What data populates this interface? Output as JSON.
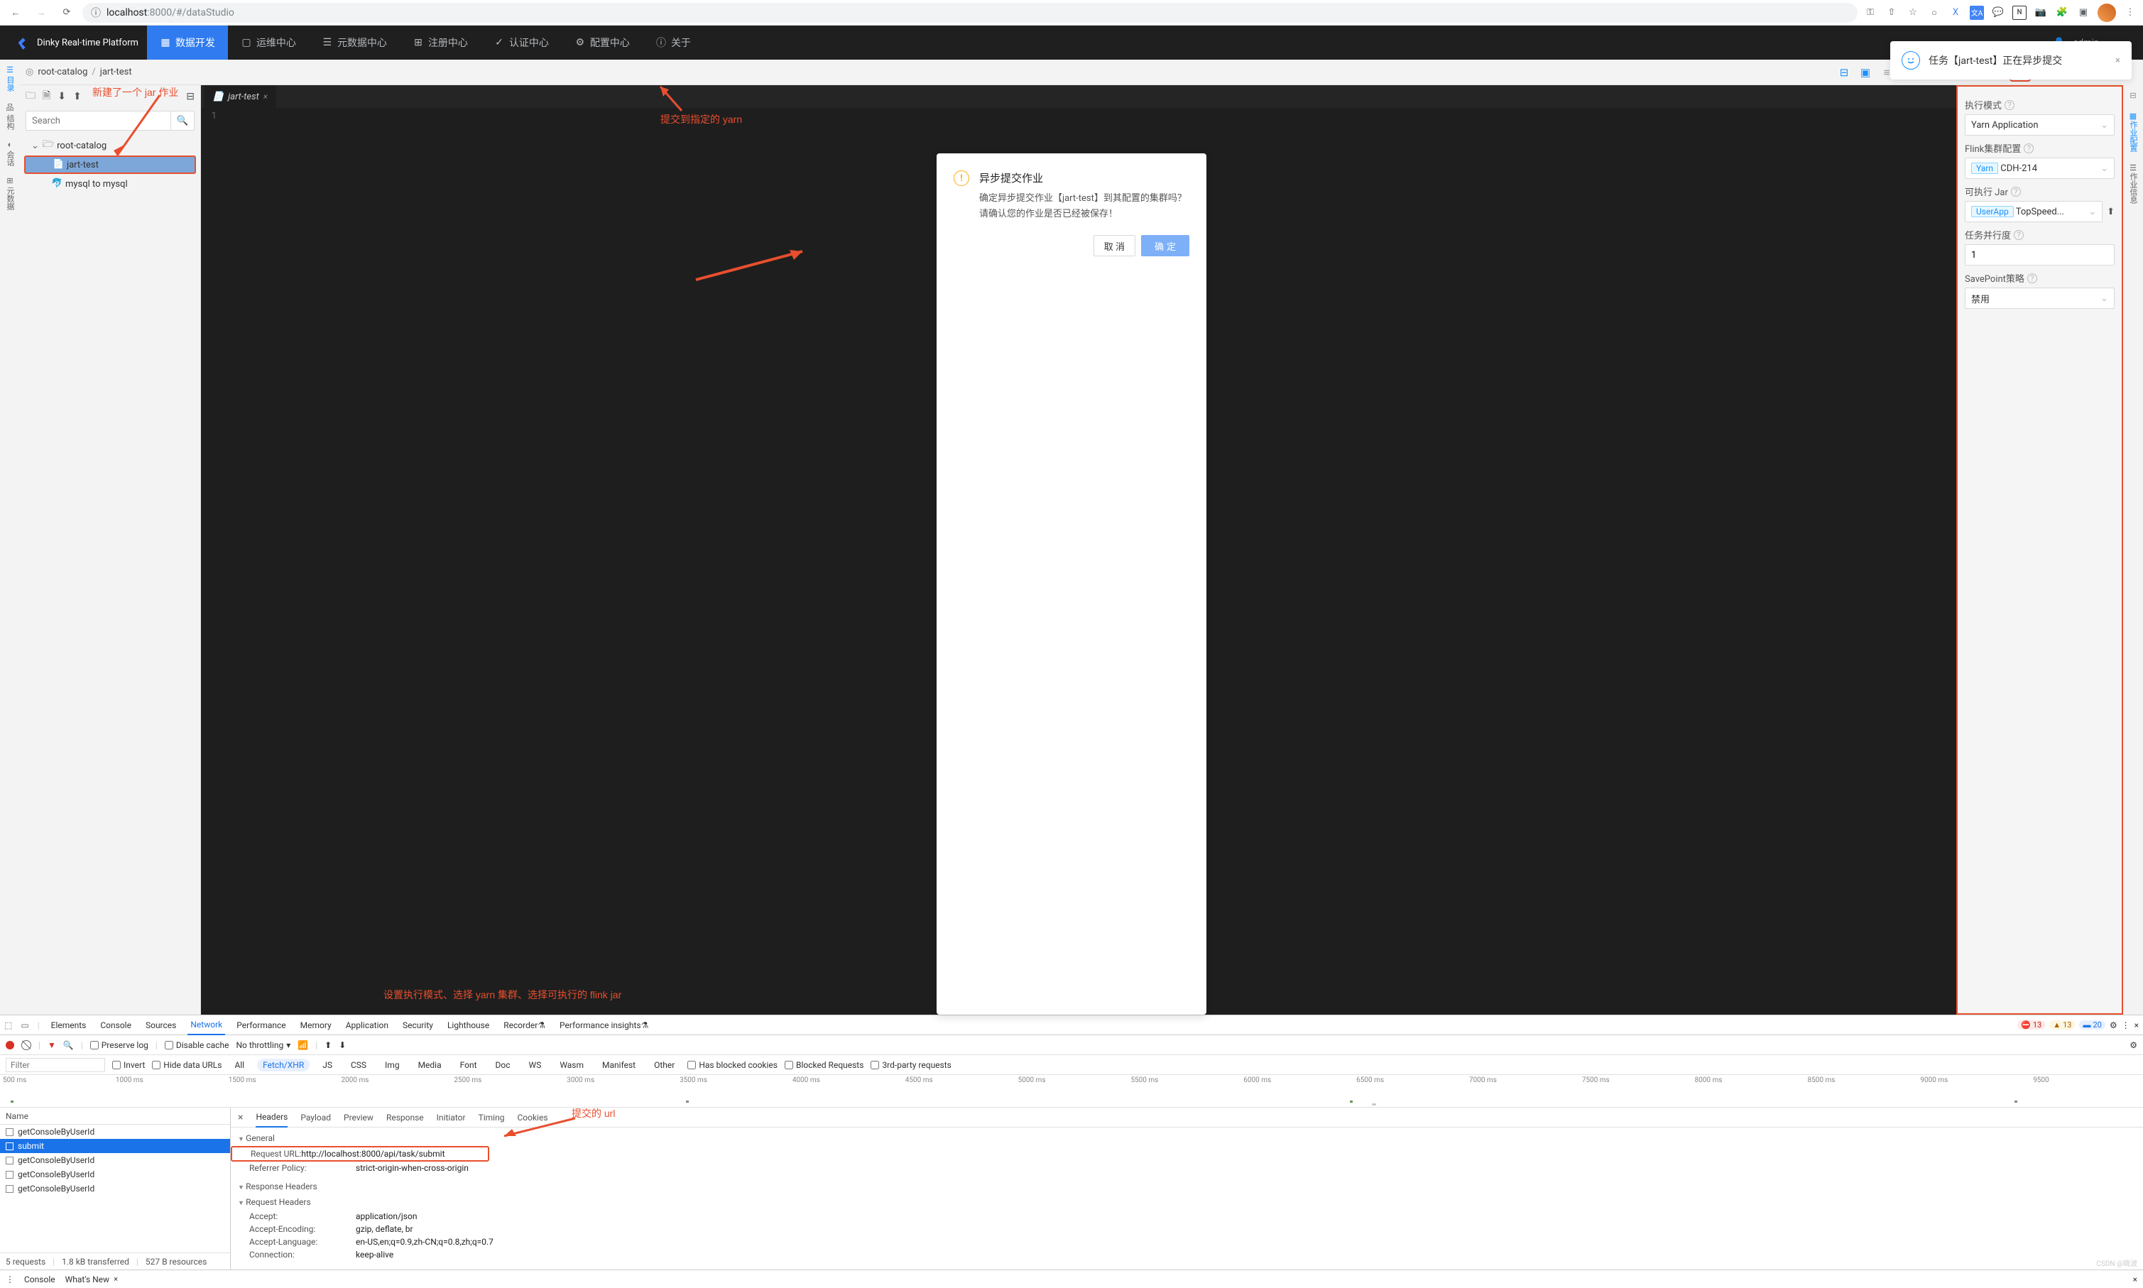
{
  "browser": {
    "url_host": "localhost",
    "url_port": ":8000",
    "url_path": "/#/dataStudio"
  },
  "header": {
    "app_name": "Dinky Real-time Platform",
    "nav": [
      {
        "label": "数据开发"
      },
      {
        "label": "运维中心"
      },
      {
        "label": "元数据中心"
      },
      {
        "label": "注册中心"
      },
      {
        "label": "认证中心"
      },
      {
        "label": "配置中心"
      },
      {
        "label": "关于"
      }
    ],
    "user": "admin"
  },
  "breadcrumb": {
    "root": "root-catalog",
    "current": "jart-test"
  },
  "left_rail": [
    {
      "label": "目录"
    },
    {
      "label": "结构"
    },
    {
      "label": "会话"
    },
    {
      "label": "元数据"
    }
  ],
  "right_rail": [
    {
      "label": "作业配置"
    },
    {
      "label": "作业信息"
    }
  ],
  "tree": {
    "search_placeholder": "Search",
    "root": "root-catalog",
    "items": [
      {
        "name": "jart-test"
      },
      {
        "name": "mysql to mysql"
      }
    ]
  },
  "editor": {
    "tab_name": "jart-test",
    "line": "1"
  },
  "right_panel": {
    "exec_mode_label": "执行模式",
    "exec_mode_value": "Yarn Application",
    "cluster_label": "Flink集群配置",
    "cluster_tag": "Yarn",
    "cluster_value": "CDH-214",
    "jar_label": "可执行 Jar",
    "jar_tag": "UserApp",
    "jar_value": "TopSpeed...",
    "parallel_label": "任务并行度",
    "parallel_value": "1",
    "savepoint_label": "SavePoint策略",
    "savepoint_value": "禁用"
  },
  "modal": {
    "title": "异步提交作业",
    "body": "确定异步提交作业【jart-test】到其配置的集群吗？请确认您的作业是否已经被保存！",
    "cancel": "取 消",
    "ok": "确定"
  },
  "toast": {
    "message": "任务【jart-test】正在异步提交"
  },
  "annotations": {
    "new_jar": "新建了一个 jar 作业",
    "submit_yarn": "提交到指定的 yarn",
    "config_note": "设置执行模式、选择 yarn 集群、选择可执行的 flink jar",
    "submit_url": "提交的 url"
  },
  "devtools": {
    "tabs": [
      "Elements",
      "Console",
      "Sources",
      "Network",
      "Performance",
      "Memory",
      "Application",
      "Security",
      "Lighthouse",
      "Recorder",
      "Performance insights"
    ],
    "active_tab": "Network",
    "err_count": "13",
    "warn_count": "13",
    "info_count": "20",
    "toolbar": {
      "preserve": "Preserve log",
      "disable_cache": "Disable cache",
      "throttle": "No throttling"
    },
    "filter_row": {
      "filter_placeholder": "Filter",
      "invert": "Invert",
      "hide_data": "Hide data URLs",
      "types": [
        "All",
        "Fetch/XHR",
        "JS",
        "CSS",
        "Img",
        "Media",
        "Font",
        "Doc",
        "WS",
        "Wasm",
        "Manifest",
        "Other"
      ],
      "active_type": "Fetch/XHR",
      "blocked_cookies": "Has blocked cookies",
      "blocked_req": "Blocked Requests",
      "third_party": "3rd-party requests"
    },
    "timeline_labels": [
      "500 ms",
      "1000 ms",
      "1500 ms",
      "2000 ms",
      "2500 ms",
      "3000 ms",
      "3500 ms",
      "4000 ms",
      "4500 ms",
      "5000 ms",
      "5500 ms",
      "6000 ms",
      "6500 ms",
      "7000 ms",
      "7500 ms",
      "8000 ms",
      "8500 ms",
      "9000 ms",
      "9500"
    ],
    "requests_header": "Name",
    "requests": [
      {
        "name": "getConsoleByUserId"
      },
      {
        "name": "submit"
      },
      {
        "name": "getConsoleByUserId"
      },
      {
        "name": "getConsoleByUserId"
      },
      {
        "name": "getConsoleByUserId"
      }
    ],
    "selected_request": 1,
    "footer": {
      "count": "5 requests",
      "transferred": "1.8 kB transferred",
      "resources": "527 B resources"
    },
    "detail_tabs": [
      "Headers",
      "Payload",
      "Preview",
      "Response",
      "Initiator",
      "Timing",
      "Cookies"
    ],
    "active_detail_tab": "Headers",
    "sections": {
      "general": "General",
      "response_h": "Response Headers",
      "request_h": "Request Headers"
    },
    "general": [
      {
        "k": "Request URL:",
        "v": "http://localhost:8000/api/task/submit"
      },
      {
        "k": "Referrer Policy:",
        "v": "strict-origin-when-cross-origin"
      }
    ],
    "request_headers": [
      {
        "k": "Accept:",
        "v": "application/json"
      },
      {
        "k": "Accept-Encoding:",
        "v": "gzip, deflate, br"
      },
      {
        "k": "Accept-Language:",
        "v": "en-US,en;q=0.9,zh-CN;q=0.8,zh;q=0.7"
      },
      {
        "k": "Connection:",
        "v": "keep-alive"
      }
    ],
    "bottom": {
      "console": "Console",
      "whatsnew": "What's New"
    }
  },
  "watermark": "CSDN @晓波"
}
